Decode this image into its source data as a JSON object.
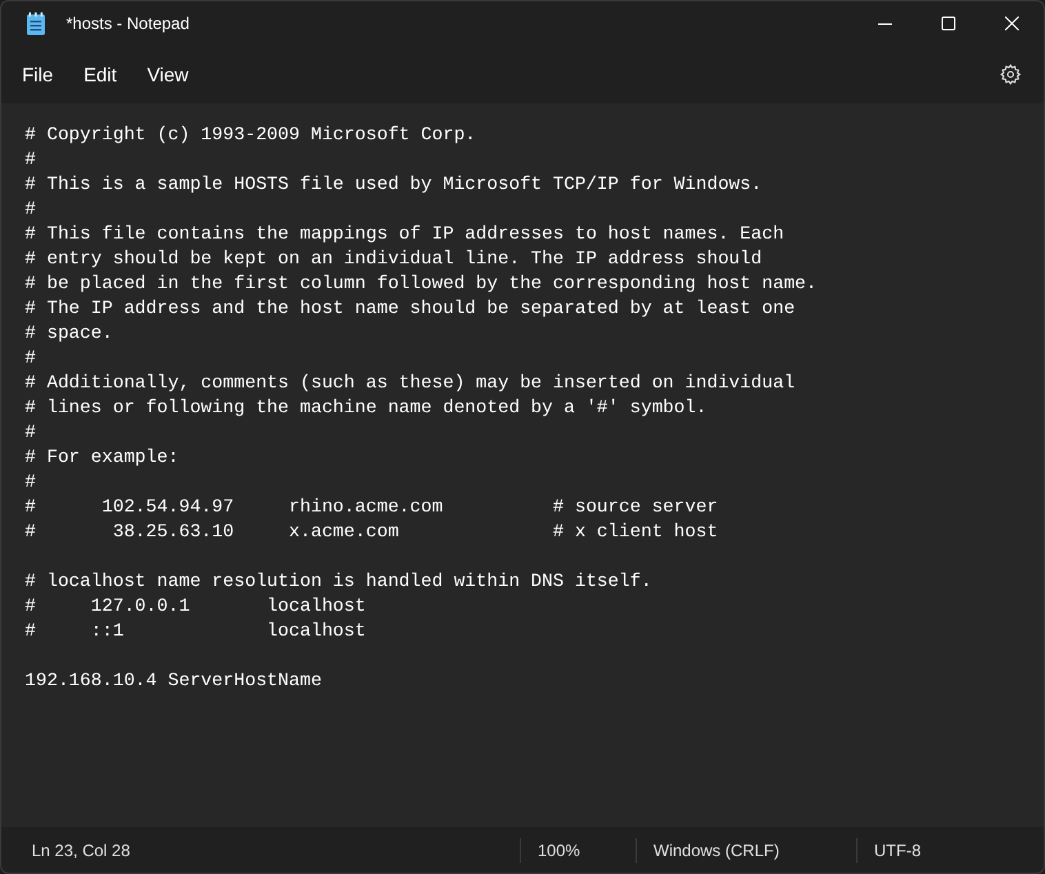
{
  "window": {
    "title": "*hosts - Notepad"
  },
  "menu": [
    "File",
    "Edit",
    "View"
  ],
  "editor": {
    "blocks": [
      [
        "# Copyright (c) 1993-2009 Microsoft Corp.",
        "#",
        "# This is a sample HOSTS file used by Microsoft TCP/IP for Windows.",
        "#",
        "# This file contains the mappings of IP addresses to host names. Each",
        "# entry should be kept on an individual line. The IP address should",
        "# be placed in the first column followed by the corresponding host name.",
        "# The IP address and the host name should be separated by at least one",
        "# space.",
        "#",
        "# Additionally, comments (such as these) may be inserted on individual",
        "# lines or following the machine name denoted by a '#' symbol.",
        "#",
        "# For example:",
        "#",
        "#      102.54.94.97     rhino.acme.com          # source server",
        "#       38.25.63.10     x.acme.com              # x client host"
      ],
      [
        "# localhost name resolution is handled within DNS itself.",
        "#     127.0.0.1       localhost",
        "#     ::1             localhost"
      ],
      [
        "192.168.10.4 ServerHostName"
      ]
    ]
  },
  "status_bar": [
    "Ln 23, Col 28",
    "100%",
    "Windows (CRLF)",
    "UTF-8"
  ]
}
